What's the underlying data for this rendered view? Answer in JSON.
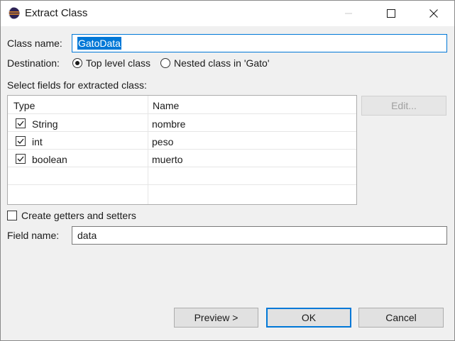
{
  "window": {
    "title": "Extract Class"
  },
  "form": {
    "class_name_label": "Class name:",
    "class_name_value": "GatoData",
    "destination_label": "Destination:",
    "destination_options": [
      {
        "label": "Top level class",
        "selected": true
      },
      {
        "label": "Nested class in 'Gato'",
        "selected": false
      }
    ],
    "fields_label": "Select fields for extracted class:",
    "edit_button": "Edit...",
    "create_getters_label": "Create getters and setters",
    "create_getters_checked": false,
    "field_name_label": "Field name:",
    "field_name_value": "data"
  },
  "table": {
    "columns": [
      "Type",
      "Name"
    ],
    "rows": [
      {
        "checked": true,
        "type": "String",
        "name": "nombre"
      },
      {
        "checked": true,
        "type": "int",
        "name": "peso"
      },
      {
        "checked": true,
        "type": "boolean",
        "name": "muerto"
      }
    ]
  },
  "buttons": {
    "preview": "Preview >",
    "ok": "OK",
    "cancel": "Cancel"
  },
  "colors": {
    "accent": "#0078d7",
    "dialog_bg": "#f0f0f0"
  },
  "icons": {
    "app": "eclipse-icon",
    "minimize": "minimize-icon",
    "maximize": "maximize-icon",
    "close": "close-icon"
  }
}
